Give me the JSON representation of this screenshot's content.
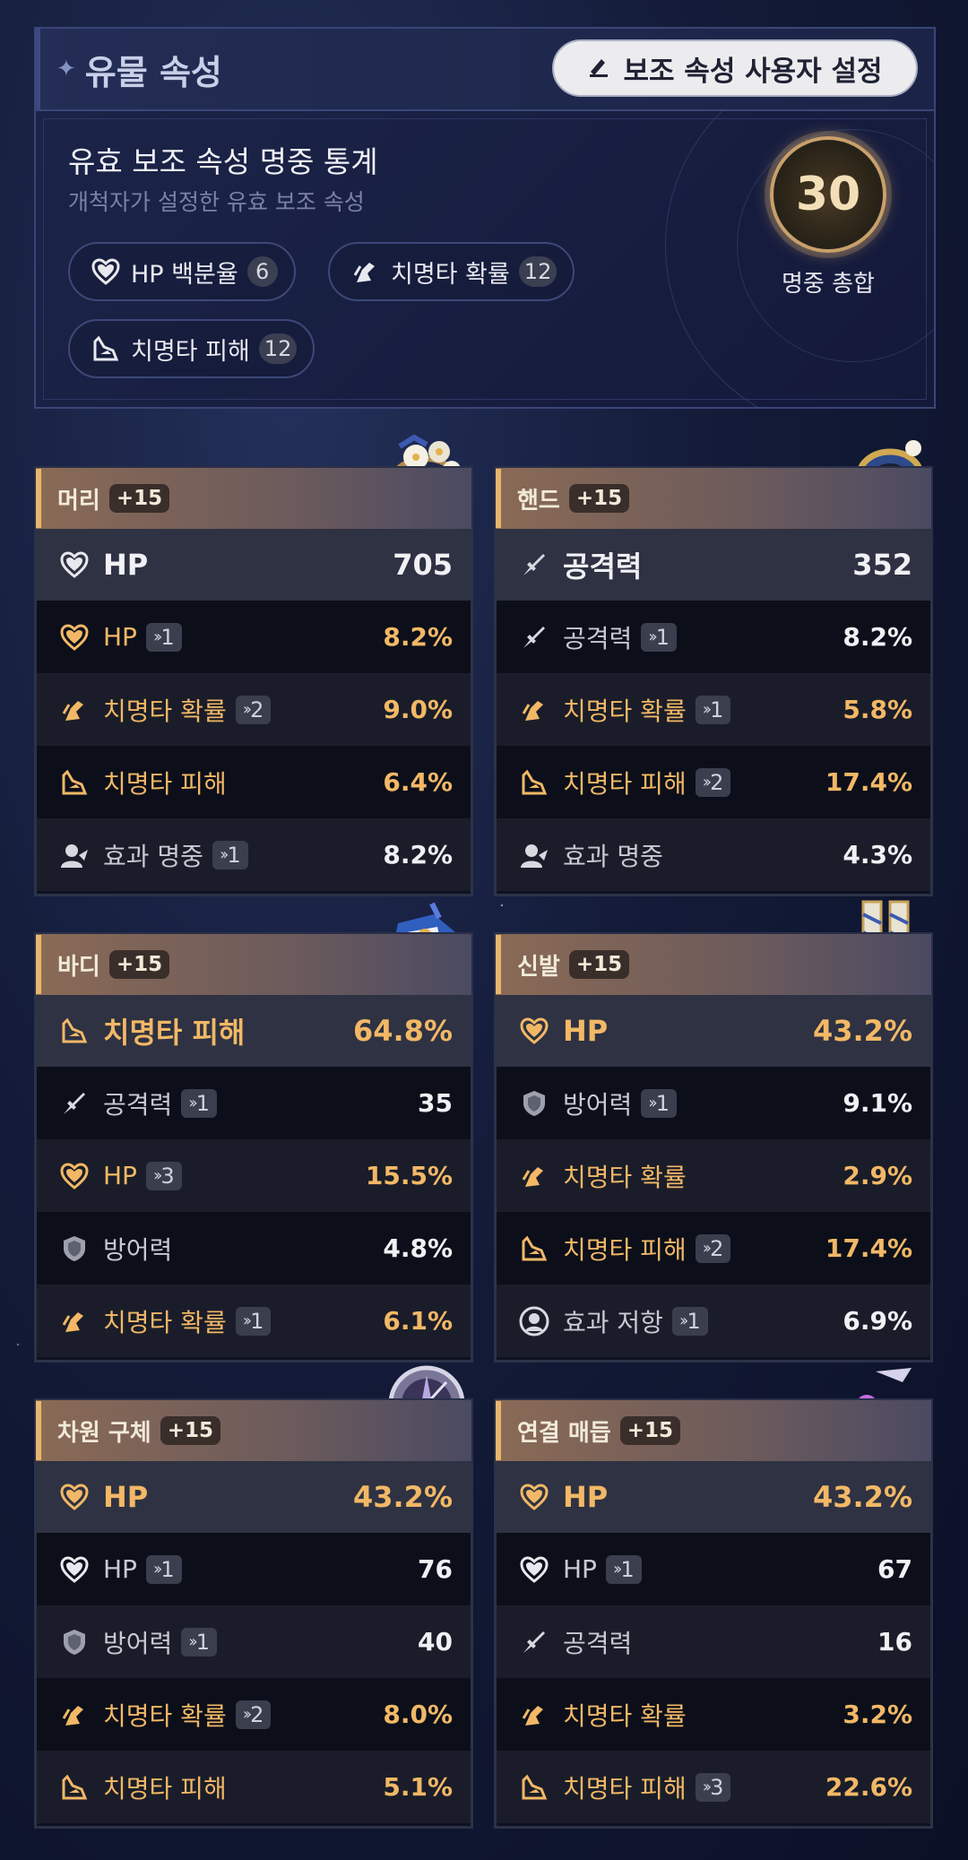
{
  "header": {
    "title": "유물 속성",
    "button_label": "보조 속성 사용자 설정"
  },
  "stats": {
    "title": "유효 보조 속성 명중 통계",
    "subtitle": "개척자가 설정한 유효 보조 속성",
    "chips": [
      {
        "label": "HP 백분율",
        "count": "6",
        "icon": "heart-icon"
      },
      {
        "label": "치명타 확률",
        "count": "12",
        "icon": "crit-rate-icon"
      },
      {
        "label": "치명타 피해",
        "count": "12",
        "icon": "crit-dmg-icon"
      }
    ],
    "total": "30",
    "total_label": "명중 총합"
  },
  "cards": [
    {
      "name": "머리",
      "level": "+15",
      "main": {
        "label": "HP",
        "value": "705",
        "icon": "heart-outline-icon",
        "highlight": false
      },
      "subs": [
        {
          "label": "HP",
          "roll": "1",
          "value": "8.2%",
          "icon": "heart-icon",
          "highlight": true
        },
        {
          "label": "치명타 확률",
          "roll": "2",
          "value": "9.0%",
          "icon": "crit-rate-icon",
          "highlight": true
        },
        {
          "label": "치명타 피해",
          "roll": "",
          "value": "6.4%",
          "icon": "crit-dmg-icon",
          "highlight": true
        },
        {
          "label": "효과 명중",
          "roll": "1",
          "value": "8.2%",
          "icon": "effect-hit-icon",
          "highlight": false
        }
      ]
    },
    {
      "name": "핸드",
      "level": "+15",
      "main": {
        "label": "공격력",
        "value": "352",
        "icon": "sword-icon",
        "highlight": false
      },
      "subs": [
        {
          "label": "공격력",
          "roll": "1",
          "value": "8.2%",
          "icon": "sword-icon",
          "highlight": false
        },
        {
          "label": "치명타 확률",
          "roll": "1",
          "value": "5.8%",
          "icon": "crit-rate-icon",
          "highlight": true
        },
        {
          "label": "치명타 피해",
          "roll": "2",
          "value": "17.4%",
          "icon": "crit-dmg-icon",
          "highlight": true
        },
        {
          "label": "효과 명중",
          "roll": "",
          "value": "4.3%",
          "icon": "effect-hit-icon",
          "highlight": false
        }
      ]
    },
    {
      "name": "바디",
      "level": "+15",
      "main": {
        "label": "치명타 피해",
        "value": "64.8%",
        "icon": "crit-dmg-icon",
        "highlight": true
      },
      "subs": [
        {
          "label": "공격력",
          "roll": "1",
          "value": "35",
          "icon": "sword-icon",
          "highlight": false
        },
        {
          "label": "HP",
          "roll": "3",
          "value": "15.5%",
          "icon": "heart-icon",
          "highlight": true
        },
        {
          "label": "방어력",
          "roll": "",
          "value": "4.8%",
          "icon": "shield-icon",
          "highlight": false
        },
        {
          "label": "치명타 확률",
          "roll": "1",
          "value": "6.1%",
          "icon": "crit-rate-icon",
          "highlight": true
        }
      ]
    },
    {
      "name": "신발",
      "level": "+15",
      "main": {
        "label": "HP",
        "value": "43.2%",
        "icon": "heart-icon",
        "highlight": true
      },
      "subs": [
        {
          "label": "방어력",
          "roll": "1",
          "value": "9.1%",
          "icon": "shield-icon",
          "highlight": false
        },
        {
          "label": "치명타 확률",
          "roll": "",
          "value": "2.9%",
          "icon": "crit-rate-icon",
          "highlight": true
        },
        {
          "label": "치명타 피해",
          "roll": "2",
          "value": "17.4%",
          "icon": "crit-dmg-icon",
          "highlight": true
        },
        {
          "label": "효과 저항",
          "roll": "1",
          "value": "6.9%",
          "icon": "effect-res-icon",
          "highlight": false
        }
      ]
    },
    {
      "name": "차원 구체",
      "level": "+15",
      "main": {
        "label": "HP",
        "value": "43.2%",
        "icon": "heart-icon",
        "highlight": true
      },
      "subs": [
        {
          "label": "HP",
          "roll": "1",
          "value": "76",
          "icon": "heart-outline-icon",
          "highlight": false
        },
        {
          "label": "방어력",
          "roll": "1",
          "value": "40",
          "icon": "shield-icon",
          "highlight": false
        },
        {
          "label": "치명타 확률",
          "roll": "2",
          "value": "8.0%",
          "icon": "crit-rate-icon",
          "highlight": true
        },
        {
          "label": "치명타 피해",
          "roll": "",
          "value": "5.1%",
          "icon": "crit-dmg-icon",
          "highlight": true
        }
      ]
    },
    {
      "name": "연결 매듭",
      "level": "+15",
      "main": {
        "label": "HP",
        "value": "43.2%",
        "icon": "heart-icon",
        "highlight": true
      },
      "subs": [
        {
          "label": "HP",
          "roll": "1",
          "value": "67",
          "icon": "heart-outline-icon",
          "highlight": false
        },
        {
          "label": "공격력",
          "roll": "",
          "value": "16",
          "icon": "sword-icon",
          "highlight": false
        },
        {
          "label": "치명타 확률",
          "roll": "",
          "value": "3.2%",
          "icon": "crit-rate-icon",
          "highlight": true
        },
        {
          "label": "치명타 피해",
          "roll": "3",
          "value": "22.6%",
          "icon": "crit-dmg-icon",
          "highlight": true
        }
      ]
    }
  ],
  "colors": {
    "gold": "#f2b866",
    "accent": "#e7b66e",
    "white": "#f0f0f5"
  }
}
